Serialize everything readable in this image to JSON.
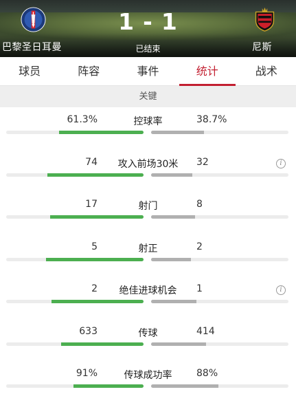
{
  "match": {
    "home_team": "巴黎圣日耳曼",
    "away_team": "尼斯",
    "home_score": "1",
    "separator": "-",
    "away_score": "1",
    "status": "已结束",
    "home_crest_icon": "psg-crest-icon",
    "away_crest_icon": "nice-crest-icon"
  },
  "tabs": [
    {
      "label": "球员",
      "active": false
    },
    {
      "label": "阵容",
      "active": false
    },
    {
      "label": "事件",
      "active": false
    },
    {
      "label": "统计",
      "active": true
    },
    {
      "label": "战术",
      "active": false
    }
  ],
  "section": {
    "title": "关键"
  },
  "colors": {
    "accent": "#c21f30",
    "home_bar": "#4caf50",
    "away_bar": "#b0b0b0"
  },
  "stats": [
    {
      "label": "控球率",
      "home": "61.3%",
      "away": "38.7%",
      "home_share": 0.613,
      "away_share": 0.387,
      "info": false
    },
    {
      "label": "攻入前场30米",
      "home": "74",
      "away": "32",
      "home_share": 0.7,
      "away_share": 0.3,
      "info": true
    },
    {
      "label": "射门",
      "home": "17",
      "away": "8",
      "home_share": 0.68,
      "away_share": 0.32,
      "info": false
    },
    {
      "label": "射正",
      "home": "5",
      "away": "2",
      "home_share": 0.71,
      "away_share": 0.29,
      "info": false
    },
    {
      "label": "绝佳进球机会",
      "home": "2",
      "away": "1",
      "home_share": 0.67,
      "away_share": 0.33,
      "info": true
    },
    {
      "label": "传球",
      "home": "633",
      "away": "414",
      "home_share": 0.6,
      "away_share": 0.4,
      "info": false
    },
    {
      "label": "传球成功率",
      "home": "91%",
      "away": "88%",
      "home_share": 0.51,
      "away_share": 0.49,
      "info": false
    }
  ]
}
